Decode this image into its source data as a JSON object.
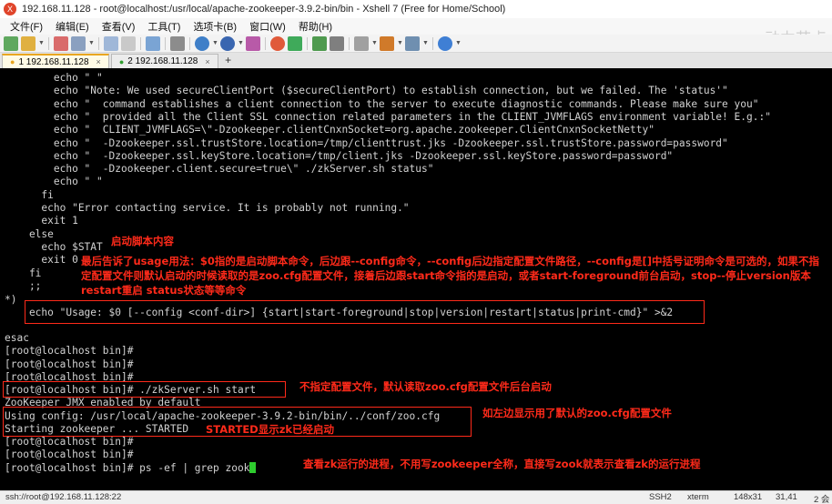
{
  "window": {
    "title": "192.168.11.128 - root@localhost:/usr/local/apache-zookeeper-3.9.2-bin/bin - Xshell 7 (Free for Home/School)"
  },
  "menu": [
    "文件(F)",
    "编辑(E)",
    "查看(V)",
    "工具(T)",
    "选项卡(B)",
    "窗口(W)",
    "帮助(H)"
  ],
  "watermark": "动力节点",
  "tabs": [
    {
      "label": "1 192.168.11.128",
      "active": true
    },
    {
      "label": "2 192.168.11.128",
      "active": false
    }
  ],
  "tab_add_label": "+",
  "tab_close_label": "×",
  "terminal": {
    "lines": [
      "        echo \" \"",
      "        echo \"Note: We used secureClientPort ($secureClientPort) to establish connection, but we failed. The 'status'\"",
      "        echo \"  command establishes a client connection to the server to execute diagnostic commands. Please make sure you\"",
      "        echo \"  provided all the Client SSL connection related parameters in the CLIENT_JVMFLAGS environment variable! E.g.:\"",
      "        echo \"  CLIENT_JVMFLAGS=\\\"-Dzookeeper.clientCnxnSocket=org.apache.zookeeper.ClientCnxnSocketNetty\"",
      "        echo \"  -Dzookeeper.ssl.trustStore.location=/tmp/clienttrust.jks -Dzookeeper.ssl.trustStore.password=password\"",
      "        echo \"  -Dzookeeper.ssl.keyStore.location=/tmp/client.jks -Dzookeeper.ssl.keyStore.password=password\"",
      "        echo \"  -Dzookeeper.client.secure=true\\\" ./zkServer.sh status\"",
      "        echo \" \"",
      "      fi",
      "      echo \"Error contacting service. It is probably not running.\"",
      "      exit 1",
      "    else",
      "      echo $STAT",
      "      exit 0",
      "    fi",
      "    ;;",
      "*)",
      "    echo \"Usage: $0 [--config <conf-dir>] {start|start-foreground|stop|version|restart|status|print-cmd}\" >&2",
      "",
      "esac",
      "[root@localhost bin]#",
      "[root@localhost bin]#",
      "[root@localhost bin]#",
      "[root@localhost bin]# ./zkServer.sh start",
      "ZooKeeper JMX enabled by default",
      "Using config: /usr/local/apache-zookeeper-3.9.2-bin/bin/../conf/zoo.cfg",
      "Starting zookeeper ... STARTED",
      "[root@localhost bin]#",
      "[root@localhost bin]#",
      "[root@localhost bin]# ps -ef | grep zook"
    ]
  },
  "annotations": {
    "startup_script": "启动脚本内容",
    "usage_note": "最后告诉了usage用法：$0指的是启动脚本命令，后边跟--config命令，--config后边指定配置文件路径，--config是[]中括号证明命令是可选的，如果不指定配置文件则默认启动的时候读取的是zoo.cfg配置文件，接着后边跟start命令指的是启动，或者start-foreground前台启动，stop--停止version版本 restart重启 status状态等等命令",
    "start_note": "不指定配置文件，默认读取zoo.cfg配置文件后台启动",
    "config_note": "如左边显示用了默认的zoo.cfg配置文件",
    "started_note": "STARTED显示zk已经启动",
    "grep_note": "查看zk运行的进程，不用写zookeeper全称，直接写zook就表示查看zk的运行进程"
  },
  "status_bar": {
    "connection": "ssh://root@192.168.11.128:22",
    "protocol": "SSH2",
    "terminal_type": "xterm",
    "size": "148x31",
    "cursor": "31,41",
    "sessions": "2 会"
  },
  "colors": {
    "annotation_red": "#ff2a1a",
    "terminal_bg": "#000000",
    "terminal_fg": "#d2d2d2",
    "cursor_green": "#2ecc2e"
  }
}
